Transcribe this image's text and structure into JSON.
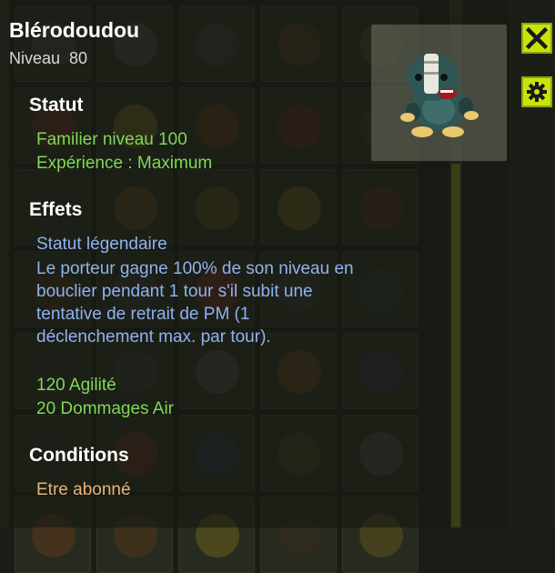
{
  "item": {
    "name": "Blérodoudou",
    "level_label": "Niveau",
    "level_value": "80"
  },
  "statut": {
    "title": "Statut",
    "lines": [
      "Familier niveau 100",
      "Expérience : Maximum"
    ]
  },
  "effets": {
    "title": "Effets",
    "name": "Statut légendaire",
    "description": "Le porteur gagne 100% de son niveau en bouclier pendant 1 tour s'il subit une tentative de retrait de PM (1 déclenchement max. par tour).",
    "stats": [
      "120 Agilité",
      "20 Dommages Air"
    ]
  },
  "conditions": {
    "title": "Conditions",
    "lines": [
      "Etre abonné"
    ]
  },
  "buttons": {
    "close_icon": "close-icon",
    "settings_icon": "gear-icon"
  },
  "colors": {
    "accent": "#c8e30c",
    "stat_green": "#7ed957",
    "effect_blue": "#8fb2f0",
    "condition_orange": "#e7b27a"
  }
}
